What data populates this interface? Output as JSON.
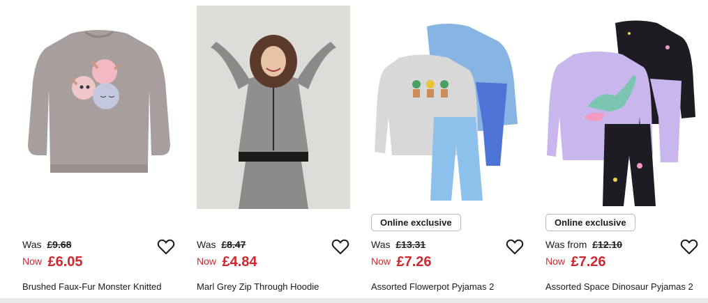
{
  "products": [
    {
      "name": "Brushed Faux-Fur Monster Knitted",
      "was_label": "Was",
      "was_price": "£9.68",
      "now_label": "Now",
      "now_price": "£6.05",
      "badge": null,
      "image_icon": "knitted-jumper-image"
    },
    {
      "name": "Marl Grey Zip Through Hoodie",
      "was_label": "Was",
      "was_price": "£8.47",
      "now_label": "Now",
      "now_price": "£4.84",
      "badge": null,
      "image_icon": "hoodie-model-image"
    },
    {
      "name": "Assorted Flowerpot Pyjamas 2",
      "was_label": "Was",
      "was_price": "£13.31",
      "now_label": "Now",
      "now_price": "£7.26",
      "badge": "Online exclusive",
      "image_icon": "flowerpot-pyjamas-image"
    },
    {
      "name": "Assorted Space Dinosaur Pyjamas 2",
      "was_label": "Was from",
      "was_price": "£12.10",
      "now_label": "Now",
      "now_price": "£7.26",
      "badge": "Online exclusive",
      "image_icon": "dinosaur-pyjamas-image"
    }
  ],
  "colors": {
    "sale_red": "#d0272f",
    "text": "#1a1a1a",
    "badge_border": "#b5b5b5"
  },
  "icons": {
    "wishlist": "heart-outline-icon"
  }
}
